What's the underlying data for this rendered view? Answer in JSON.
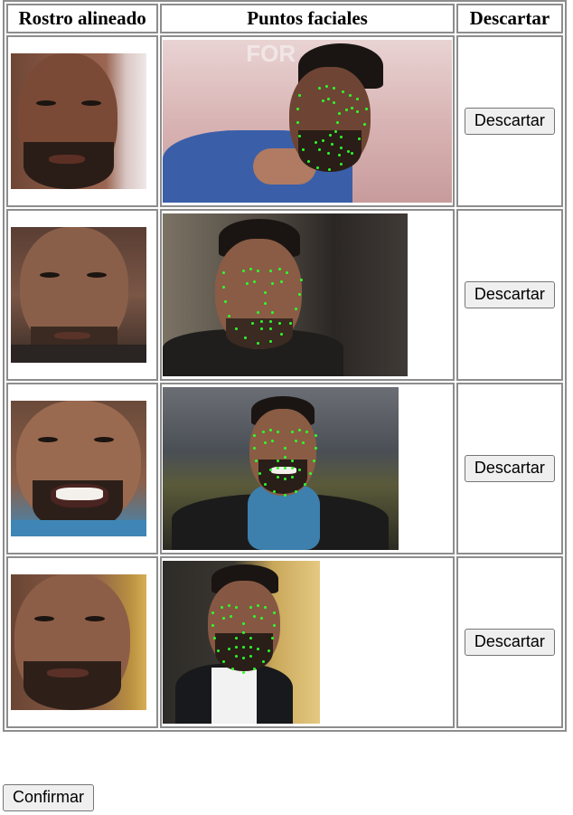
{
  "table": {
    "headers": {
      "aligned": "Rostro alineado",
      "points": "Puntos faciales",
      "discard": "Descartar"
    },
    "rows": [
      {
        "discard_label": "Descartar",
        "backdrop_text": "FOR"
      },
      {
        "discard_label": "Descartar"
      },
      {
        "discard_label": "Descartar"
      },
      {
        "discard_label": "Descartar"
      }
    ]
  },
  "confirm_label": "Confirmar",
  "colors": {
    "landmark": "#2bff2b",
    "border": "#8d8d8d",
    "button_bg": "#efefef"
  }
}
